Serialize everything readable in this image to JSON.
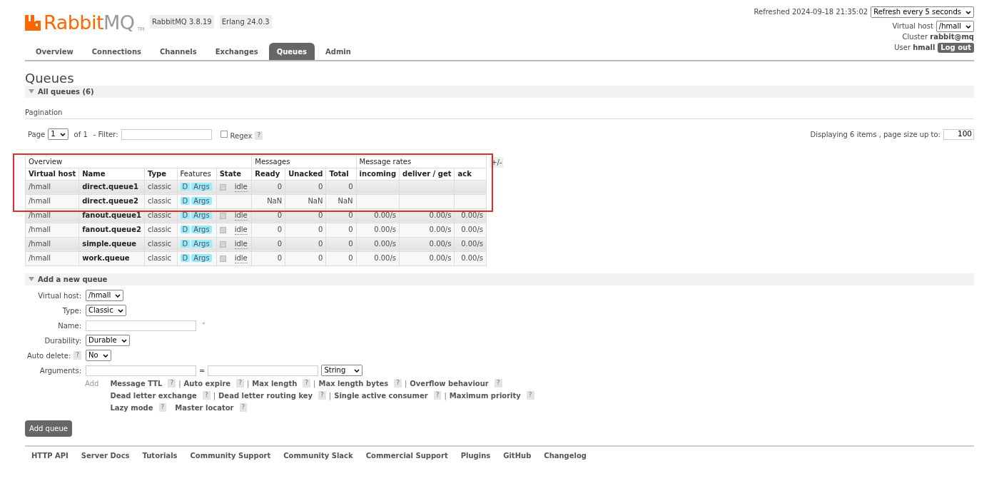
{
  "logo": {
    "primary": "Rabbit",
    "secondary": "MQ",
    "tm": "TM"
  },
  "versions": [
    "RabbitMQ 3.8.19",
    "Erlang 24.0.3"
  ],
  "tabs": [
    {
      "label": "Overview",
      "selected": false
    },
    {
      "label": "Connections",
      "selected": false
    },
    {
      "label": "Channels",
      "selected": false
    },
    {
      "label": "Exchanges",
      "selected": false
    },
    {
      "label": "Queues",
      "selected": true
    },
    {
      "label": "Admin",
      "selected": false
    }
  ],
  "status": {
    "refreshed": "Refreshed 2024-09-18 21:35:02",
    "refresh_select": "Refresh every 5 seconds",
    "vhost_label": "Virtual host",
    "vhost": "/hmall",
    "cluster_label": "Cluster",
    "cluster": "rabbit@mq",
    "user_label": "User",
    "user": "hmall",
    "logout": "Log out"
  },
  "page_title": "Queues",
  "all_queues": {
    "label": "All queues (6)",
    "expanded": true
  },
  "pagination": {
    "heading": "Pagination",
    "page_label": "Page",
    "page": "1",
    "of": "of 1",
    "filter_label": "- Filter:",
    "regex": "Regex",
    "regex_checked": false,
    "help": "?",
    "displaying": "Displaying 6 items , page size up to:",
    "page_size": "100"
  },
  "table": {
    "groups": [
      {
        "label": "Overview"
      },
      {
        "label": "Messages"
      },
      {
        "label": "Message rates"
      }
    ],
    "toggle": "+/-",
    "annotation": {
      "kind": "highlight-box"
    },
    "columns": [
      "Virtual host",
      "Name",
      "Type",
      "Features",
      "State",
      "Ready",
      "Unacked",
      "Total",
      "incoming",
      "deliver / get",
      "ack"
    ],
    "rows": [
      {
        "vhost": "/hmall",
        "name": "direct.queue1",
        "type": "classic",
        "features": [
          "D",
          "Args"
        ],
        "state": "idle",
        "ready": "0",
        "unacked": "0",
        "total": "0"
      },
      {
        "vhost": "/hmall",
        "name": "direct.queue2",
        "type": "classic",
        "features": [
          "D",
          "Args"
        ],
        "ready": "NaN",
        "unacked": "NaN",
        "total": "NaN"
      },
      {
        "vhost": "/hmall",
        "name": "fanout.queue1",
        "type": "classic",
        "features": [
          "D",
          "Args"
        ],
        "state": "idle",
        "ready": "0",
        "unacked": "0",
        "total": "0",
        "incoming": "0.00/s",
        "deliver_get": "0.00/s",
        "ack": "0.00/s"
      },
      {
        "vhost": "/hmall",
        "name": "fanout.queue2",
        "type": "classic",
        "features": [
          "D",
          "Args"
        ],
        "state": "idle",
        "ready": "0",
        "unacked": "0",
        "total": "0",
        "incoming": "0.00/s",
        "deliver_get": "0.00/s",
        "ack": "0.00/s"
      },
      {
        "vhost": "/hmall",
        "name": "simple.queue",
        "type": "classic",
        "features": [
          "D",
          "Args"
        ],
        "state": "idle",
        "ready": "0",
        "unacked": "0",
        "total": "0",
        "incoming": "0.00/s",
        "deliver_get": "0.00/s",
        "ack": "0.00/s"
      },
      {
        "vhost": "/hmall",
        "name": "work.queue",
        "type": "classic",
        "features": [
          "D",
          "Args"
        ],
        "state": "idle",
        "ready": "0",
        "unacked": "0",
        "total": "0",
        "incoming": "0.00/s",
        "deliver_get": "0.00/s",
        "ack": "0.00/s"
      }
    ]
  },
  "add_queue": {
    "heading": "Add a new queue",
    "expanded": true,
    "fields": [
      {
        "kind": "select",
        "label": "Virtual host:",
        "value": "/hmall"
      },
      {
        "kind": "select",
        "label": "Type:",
        "value": "Classic"
      },
      {
        "kind": "text",
        "label": "Name:",
        "required": "*"
      },
      {
        "kind": "select",
        "label": "Durability:",
        "value": "Durable"
      },
      {
        "kind": "select",
        "label": "Auto delete:",
        "help": "?",
        "value": "No"
      },
      {
        "kind": "arguments",
        "label": "Arguments:",
        "equals": "=",
        "value": "String"
      }
    ],
    "add_label": "Add",
    "argument_lines": [
      [
        {
          "label": "Message TTL",
          "help": "?",
          "separator": "|"
        },
        {
          "label": "Auto expire",
          "help": "?",
          "separator": "|"
        },
        {
          "label": "Max length",
          "help": "?",
          "separator": "|"
        },
        {
          "label": "Max length bytes",
          "help": "?",
          "separator": "|"
        },
        {
          "label": "Overflow behaviour",
          "help": "?"
        }
      ],
      [
        {
          "label": "Dead letter exchange",
          "help": "?",
          "separator": "|"
        },
        {
          "label": "Dead letter routing key",
          "help": "?",
          "separator": "|"
        },
        {
          "label": "Single active consumer",
          "help": "?",
          "separator": "|"
        },
        {
          "label": "Maximum priority",
          "help": "?"
        }
      ],
      [
        {
          "label": "Lazy mode",
          "help": "?"
        },
        {
          "label": "Master locator",
          "help": "?"
        }
      ]
    ],
    "submit": "Add queue"
  },
  "footer": [
    "HTTP API",
    "Server Docs",
    "Tutorials",
    "Community Support",
    "Community Slack",
    "Commercial Support",
    "Plugins",
    "GitHub",
    "Changelog"
  ]
}
